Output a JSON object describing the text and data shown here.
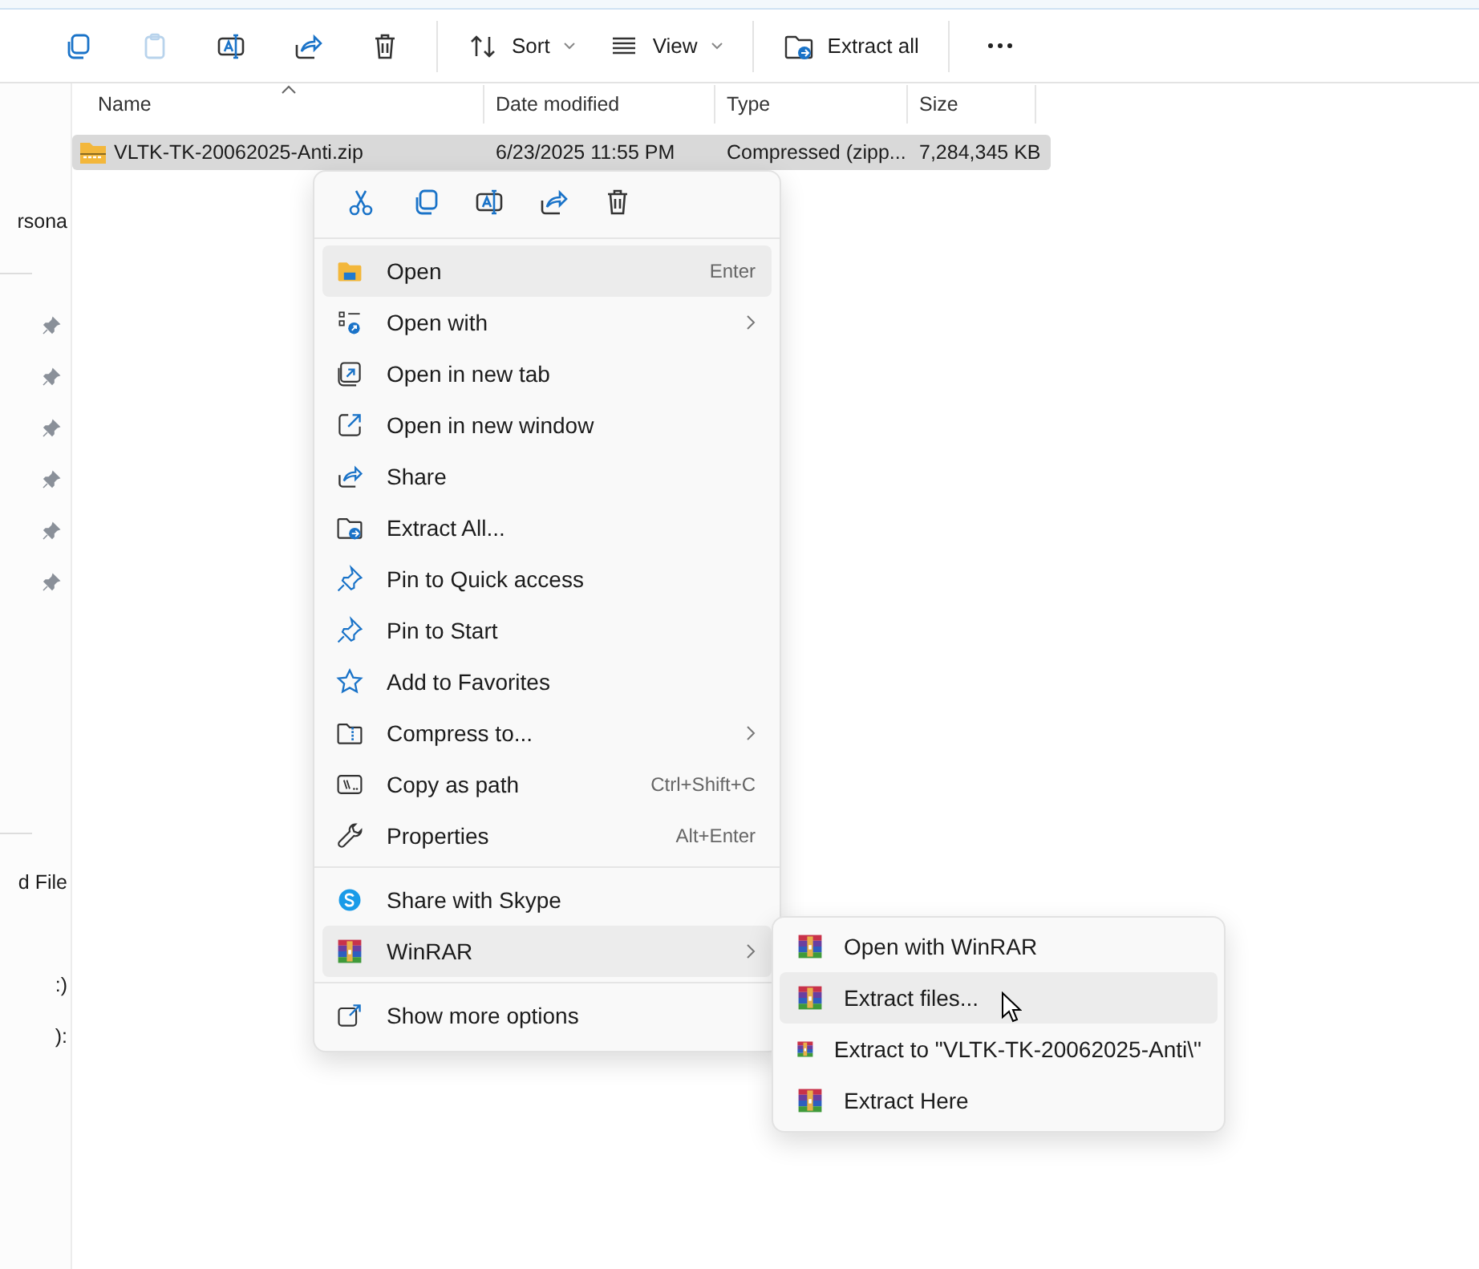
{
  "toolbar": [
    {
      "kind": "icon",
      "disabled": false
    },
    {
      "kind": "icon",
      "disabled": true
    },
    {
      "kind": "icon",
      "disabled": false
    },
    {
      "kind": "icon",
      "disabled": false
    },
    {
      "kind": "icon",
      "disabled": false
    },
    {
      "kind": "dropdown",
      "label": "Sort"
    },
    {
      "kind": "dropdown",
      "label": "View"
    },
    {
      "kind": "button",
      "label": "Extract all"
    },
    {
      "kind": "more"
    }
  ],
  "sidebar": {
    "items": [
      {
        "label": "rsona"
      },
      {
        "label": "d File"
      },
      {
        "label": ":)"
      },
      {
        "label": "):"
      }
    ]
  },
  "file_list": {
    "columns": [
      "Name",
      "Date modified",
      "Type",
      "Size"
    ],
    "rows": [
      {
        "cells": [
          "VLTK-TK-20062025-Anti.zip",
          "6/23/2025 11:55 PM",
          "Compressed (zipp...",
          "7,284,345 KB"
        ],
        "selected": true
      }
    ]
  },
  "context_menu": {
    "groups": [
      [
        {
          "label": "Open",
          "shortcut": "Enter",
          "submenu": false,
          "selected": true
        },
        {
          "label": "Open with",
          "submenu": true,
          "selected": false
        },
        {
          "label": "Open in new tab",
          "submenu": false,
          "selected": false
        },
        {
          "label": "Open in new window",
          "submenu": false,
          "selected": false
        },
        {
          "label": "Share",
          "submenu": false,
          "selected": false
        },
        {
          "label": "Extract All...",
          "submenu": false,
          "selected": false
        },
        {
          "label": "Pin to Quick access",
          "submenu": false,
          "selected": false
        },
        {
          "label": "Pin to Start",
          "submenu": false,
          "selected": false
        },
        {
          "label": "Add to Favorites",
          "submenu": false,
          "selected": false
        },
        {
          "label": "Compress to...",
          "submenu": true,
          "selected": false
        },
        {
          "label": "Copy as path",
          "shortcut": "Ctrl+Shift+C",
          "submenu": false,
          "selected": false
        },
        {
          "label": "Properties",
          "shortcut": "Alt+Enter",
          "submenu": false,
          "selected": false
        }
      ],
      [
        {
          "label": "Share with Skype",
          "submenu": false,
          "selected": false
        },
        {
          "label": "WinRAR",
          "submenu": true,
          "selected": true
        }
      ],
      [
        {
          "label": "Show more options",
          "submenu": false,
          "selected": false
        }
      ]
    ]
  },
  "submenu": {
    "items": [
      {
        "label": "Open with WinRAR",
        "selected": false
      },
      {
        "label": "Extract files...",
        "selected": true
      },
      {
        "label": "Extract to \"VLTK-TK-20062025-Anti\\\"",
        "selected": false
      },
      {
        "label": "Extract Here",
        "selected": false
      }
    ]
  }
}
